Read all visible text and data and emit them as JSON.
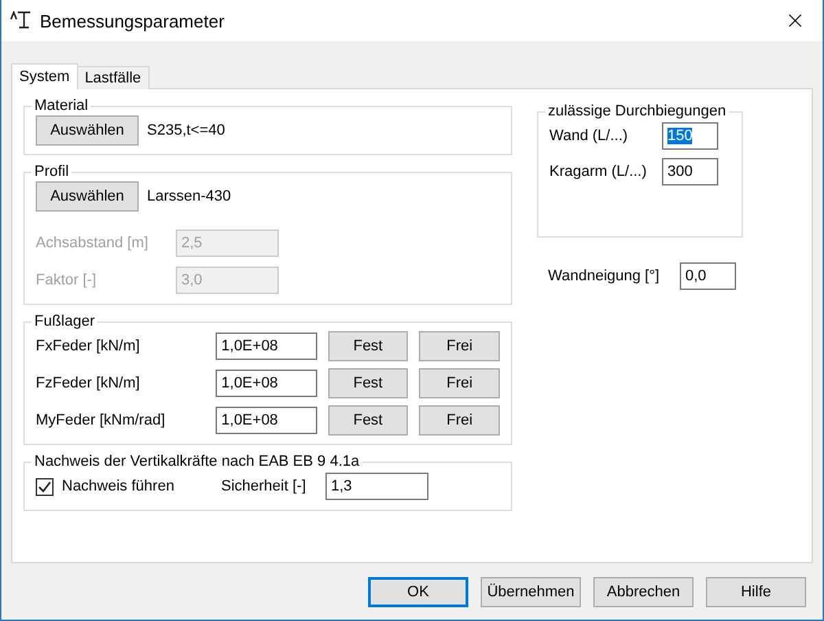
{
  "window": {
    "title": "Bemessungsparameter"
  },
  "tabs": [
    {
      "label": "System",
      "selected": true
    },
    {
      "label": "Lastfälle",
      "selected": false
    }
  ],
  "material": {
    "title": "Material",
    "button": "Auswählen",
    "value": "S235,t<=40"
  },
  "profil": {
    "title": "Profil",
    "button": "Auswählen",
    "value": "Larssen-430",
    "fields": [
      {
        "label": "Achsabstand [m]",
        "value": "2,5",
        "disabled": true
      },
      {
        "label": "Faktor [-]",
        "value": "3,0",
        "disabled": true
      }
    ]
  },
  "fusslager": {
    "title": "Fußlager",
    "rows": [
      {
        "label": "FxFeder [kN/m]",
        "value": "1,0E+08",
        "buttons": [
          "Fest",
          "Frei"
        ]
      },
      {
        "label": "FzFeder [kN/m]",
        "value": "1,0E+08",
        "buttons": [
          "Fest",
          "Frei"
        ]
      },
      {
        "label": "MyFeder [kNm/rad]",
        "value": "1,0E+08",
        "buttons": [
          "Fest",
          "Frei"
        ]
      }
    ]
  },
  "nachweis": {
    "title": "Nachweis der Vertikalkräfte nach EAB EB 9 4.1a",
    "checkbox": {
      "label": "Nachweis führen",
      "checked": true
    },
    "field": {
      "label": "Sicherheit [-]",
      "value": "1,3"
    }
  },
  "durchbiegungen": {
    "title": "zulässige Durchbiegungen",
    "fields": [
      {
        "label": "Wand (L/...)",
        "value": "150",
        "selected": true
      },
      {
        "label": "Kragarm (L/...)",
        "value": "300",
        "selected": false
      }
    ]
  },
  "wandneigung": {
    "label": "Wandneigung [°]",
    "value": "0,0"
  },
  "buttons": [
    {
      "label": "OK",
      "default": true
    },
    {
      "label": "Übernehmen",
      "default": false
    },
    {
      "label": "Abbrechen",
      "default": false
    },
    {
      "label": "Hilfe",
      "default": false
    }
  ]
}
